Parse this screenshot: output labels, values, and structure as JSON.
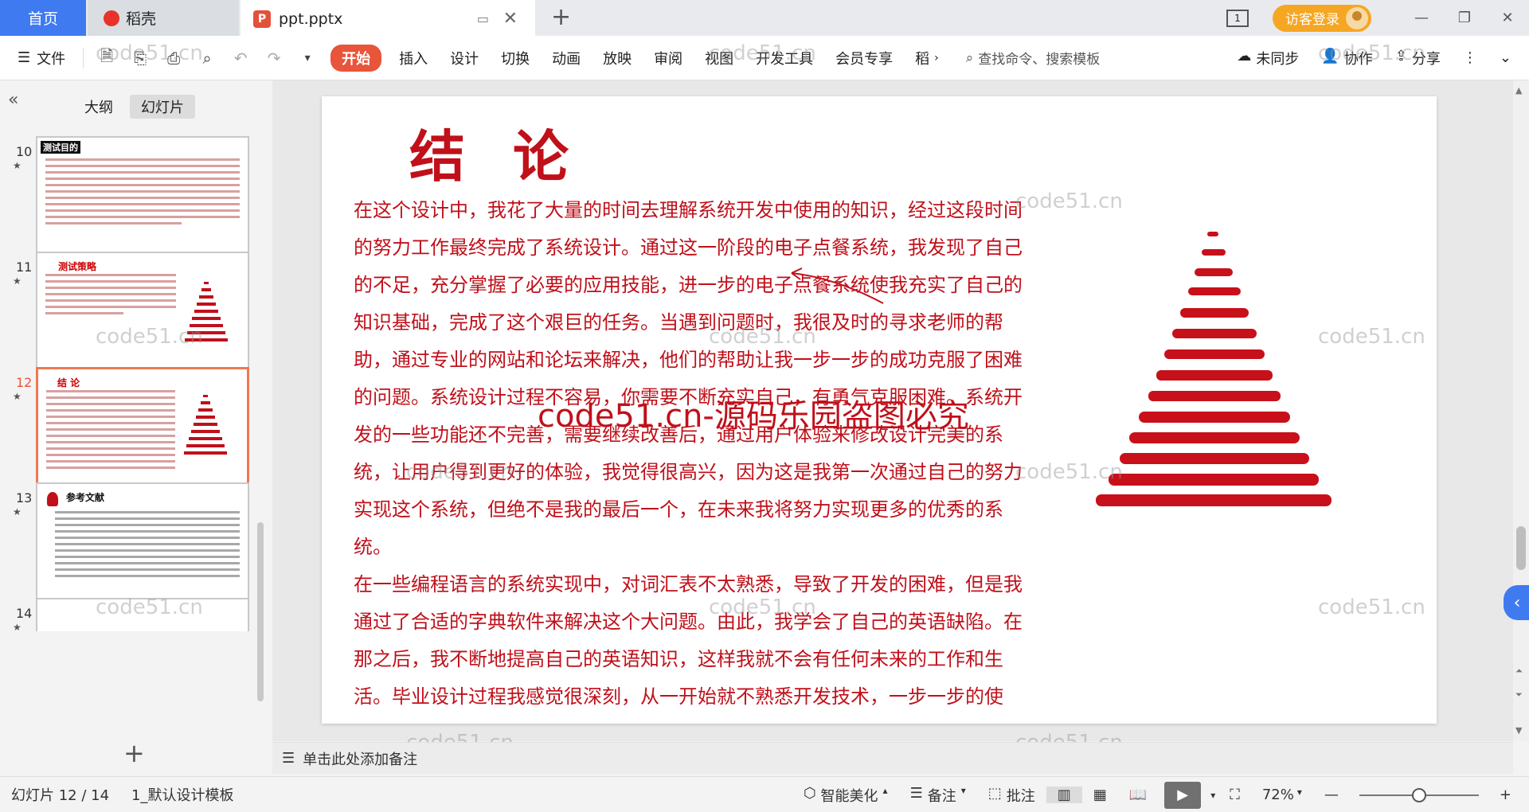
{
  "titlebar": {
    "home_tab": "首页",
    "daoke_tab": "稻壳",
    "file_tab": "ppt.pptx",
    "new_tab_symbol": "+",
    "page_badge": "1",
    "login_label": "访客登录"
  },
  "toolbar": {
    "file_menu": "文件",
    "tabs": [
      "开始",
      "插入",
      "设计",
      "切换",
      "动画",
      "放映",
      "审阅",
      "视图",
      "开发工具",
      "会员专享",
      "稻"
    ],
    "search_placeholder": "查找命令、搜索模板",
    "sync_label": "未同步",
    "collab_label": "协作",
    "share_label": "分享"
  },
  "left_panel": {
    "tab_outline": "大纲",
    "tab_slides": "幻灯片",
    "slides": [
      {
        "num": "10",
        "title": "测试目的"
      },
      {
        "num": "11",
        "title": "测试策略"
      },
      {
        "num": "12",
        "title": "结  论"
      },
      {
        "num": "13",
        "title": "参考文献"
      },
      {
        "num": "14",
        "title": ""
      }
    ],
    "add_symbol": "+"
  },
  "slide": {
    "title": "结论",
    "paragraphs": [
      "在这个设计中，我花了大量的时间去理解系统开发中使用的知识，经过这段时间的努力工作最终完成了系统设计。通过这一阶段的电子点餐系统，我发现了自己的不足，充分掌握了必要的应用技能，进一步的电子点餐系统使我充实了自己的知识基础，完成了这个艰巨的任务。当遇到问题时，我很及时的寻求老师的帮助，通过专业的网站和论坛来解决，他们的帮助让我一步一步的成功克服了困难的问题。系统设计过程不容易，你需要不断充实自己，有勇气克服困难。系统开发的一些功能还不完善，需要继续改善后，通过用户体验来修改设计完美的系统，让用户得到更好的体验，我觉得很高兴，因为这是我第一次通过自己的努力实现这个系统，但绝不是我的最后一个，在未来我将努力实现更多的优秀的系统。",
      "在一些编程语言的系统实现中，对词汇表不太熟悉，导致了开发的困难，但是我通过了合适的字典软件来解决这个大问题。由此，我学会了自己的英语缺陷。在那之后，我不断地提高自己的英语知识，这样我就不会有任何未来的工作和生活。毕业设计过程我感觉很深刻，从一开始就不熟悉开发技术，一步一步的使用，接触到文献和信息，不难理解，系统是一次又"
    ]
  },
  "notes_placeholder": "单击此处添加备注",
  "watermark": {
    "small": "code51.cn",
    "big": "code51.cn-源码乐园盗图必究"
  },
  "statusbar": {
    "slide_counter": "幻灯片 12 / 14",
    "template": "1_默认设计模板",
    "beautify": "智能美化",
    "notes": "备注",
    "comment": "批注",
    "zoom": "72%"
  }
}
